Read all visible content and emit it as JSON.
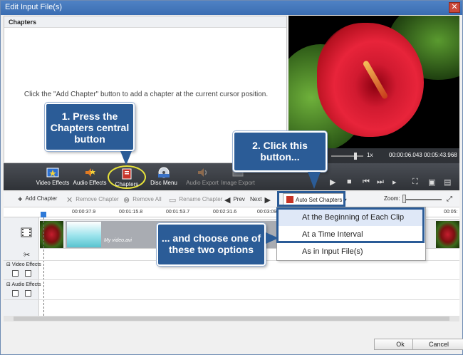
{
  "window": {
    "title": "Edit Input File(s)",
    "close_glyph": "✕"
  },
  "chapters_panel": {
    "header": "Chapters",
    "hint": "Click the \"Add Chapter\" button to add a chapter at the current cursor position."
  },
  "preview": {
    "speed": "1x",
    "time_current": "00:00:06.043",
    "time_total": "00:05:43.968"
  },
  "strip": {
    "items": [
      {
        "label": "Video Effects",
        "icon": "video-effects-icon"
      },
      {
        "label": "Audio Effects",
        "icon": "audio-effects-icon"
      },
      {
        "label": "Chapters",
        "icon": "chapters-icon"
      },
      {
        "label": "Disc Menu",
        "icon": "disc-menu-icon"
      },
      {
        "label": "Audio Export",
        "icon": "audio-export-icon"
      },
      {
        "label": "Image Export",
        "icon": "image-export-icon"
      }
    ]
  },
  "toolbar": {
    "add_chapter": "Add Chapter",
    "remove_chapter": "Remove Chapter",
    "remove_all": "Remove All",
    "rename_chapter": "Rename Chapter",
    "prev": "Prev",
    "next": "Next",
    "auto_set": "Auto Set Chapters",
    "zoom": "Zoom:"
  },
  "ruler": {
    "ticks": [
      "00:00:37.9",
      "00:01:15.8",
      "00:01:53.7",
      "00:02:31.6",
      "00:03:09",
      "00:05:"
    ]
  },
  "timeline": {
    "clip_label": "My video.avi",
    "video_effects": "Video Effects",
    "audio_effects": "Audio Effects"
  },
  "dropdown": {
    "options": [
      "At the Beginning of Each Clip",
      "At a Time Interval",
      "As in Input File(s)"
    ]
  },
  "callouts": {
    "step1": "1. Press the Chapters central button",
    "step2": "2. Click this button...",
    "step3": "... and choose one of these two options"
  },
  "buttons": {
    "ok": "Ok",
    "cancel": "Cancel"
  },
  "colors": {
    "accent": "#2b5c97",
    "highlight_ring": "#e8e33a"
  }
}
